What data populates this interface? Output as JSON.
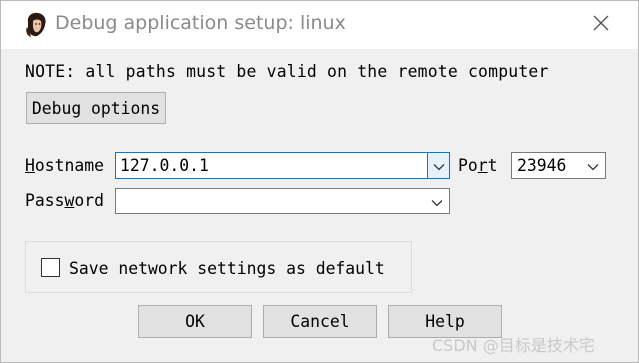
{
  "window": {
    "title": "Debug application setup: linux"
  },
  "note": "NOTE: all paths must be valid on the remote computer",
  "buttons": {
    "debug_options": "Debug options",
    "ok": "OK",
    "cancel": "Cancel",
    "help": "Help"
  },
  "hostname": {
    "label_first": "H",
    "label_rest": "ostname",
    "value": "127.0.0.1"
  },
  "port": {
    "label_first": "Po",
    "label_underline": "r",
    "label_rest": "t",
    "value": "23946"
  },
  "password": {
    "label_first": "Pass",
    "label_underline": "w",
    "label_rest": "ord",
    "value": ""
  },
  "save_default": {
    "label": "Save network settings as default",
    "checked": false
  },
  "watermark": "CSDN @目标是技术宅",
  "icons": {
    "app": "app-avatar-icon",
    "close": "close-icon",
    "dropdown": "chevron-down-icon"
  },
  "colors": {
    "focus_border": "#0078d7",
    "button_face": "#e1e1e1",
    "dialog_bg": "#f0f0f0"
  }
}
